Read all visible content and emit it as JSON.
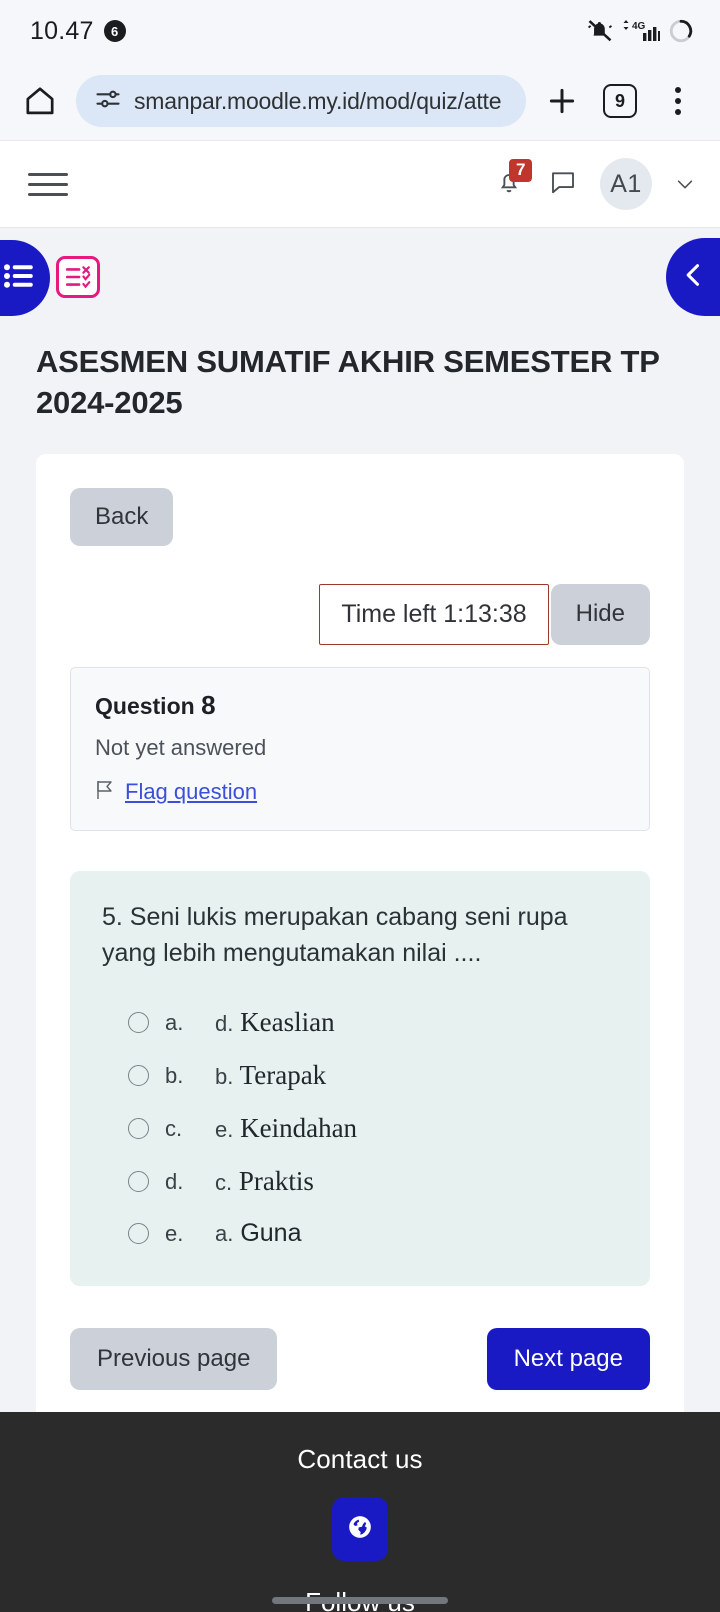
{
  "status_bar": {
    "clock": "10.47",
    "notification_count": "6",
    "icons": [
      "bell-muted-icon",
      "signal-4g-icon",
      "battery-icon"
    ]
  },
  "browser": {
    "home_icon": "home-icon",
    "site_settings_icon": "tune-icon",
    "url": "smanpar.moodle.my.id/mod/quiz/atte",
    "new_tab_icon": "plus-icon",
    "tab_count": "9",
    "menu_icon": "kebab-menu-icon"
  },
  "moodle_nav": {
    "menu_icon": "hamburger-icon",
    "notifications_icon": "bell-icon",
    "notifications_badge": "7",
    "messages_icon": "speech-bubble-icon",
    "avatar_initials": "A1",
    "user_menu_icon": "chevron-down-icon",
    "left_drawer_icon": "list-icon",
    "right_drawer_icon": "chevron-left-icon",
    "activity_icon": "quiz-checklist-icon"
  },
  "page": {
    "title": "ASESMEN SUMATIF AKHIR SEMESTER TP 2024-2025",
    "back_label": "Back"
  },
  "timer": {
    "label": "Time left 1:13:38",
    "hide_label": "Hide",
    "border_color": "#9a392c"
  },
  "question_info": {
    "heading_prefix": "Question",
    "number": "8",
    "state": "Not yet answered",
    "flag_icon": "flag-icon",
    "flag_label": "Flag question"
  },
  "question": {
    "text": "5. Seni lukis merupakan cabang seni rupa yang lebih mengutamakan nilai ....",
    "options": [
      {
        "key": "a.",
        "label": "d.",
        "text": "Keaslian",
        "serif": true,
        "selected": false
      },
      {
        "key": "b.",
        "label": "b.",
        "text": "Terapak",
        "serif": true,
        "selected": false
      },
      {
        "key": "c.",
        "label": "e.",
        "text": "Keindahan",
        "serif": true,
        "selected": false
      },
      {
        "key": "d.",
        "label": "c.",
        "text": "Praktis",
        "serif": true,
        "selected": false
      },
      {
        "key": "e.",
        "label": "a.",
        "text": "Guna",
        "serif": false,
        "selected": false
      }
    ]
  },
  "pagination": {
    "previous_label": "Previous page",
    "next_label": "Next page"
  },
  "footer": {
    "contact_heading": "Contact us",
    "website_icon": "globe-icon",
    "follow_heading": "Follow us"
  },
  "colors": {
    "brand_blue": "#1a1ac4",
    "accent_pink": "#e5197f",
    "page_bg": "#f1f3f7",
    "question_bg": "#e6f1f0",
    "footer_bg": "#2b2b2b",
    "badge_red": "#c0362c"
  }
}
